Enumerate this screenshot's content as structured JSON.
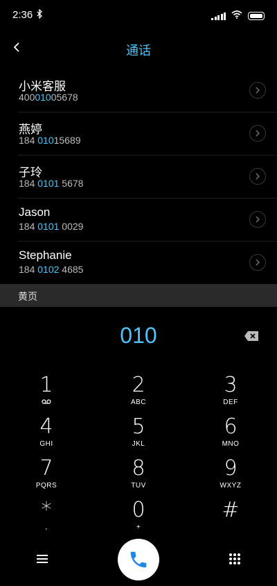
{
  "status": {
    "time": "2:36"
  },
  "header": {
    "title": "通话"
  },
  "contacts": [
    {
      "name": "小米客服",
      "num_pre": "400",
      "num_hl": "010",
      "num_post": "05678"
    },
    {
      "name": "燕婷",
      "num_pre": "184 ",
      "num_hl": "010",
      "num_post": "15689"
    },
    {
      "name": "子玲",
      "num_pre": "184 ",
      "num_hl": "0101",
      "num_post": " 5678"
    },
    {
      "name": "Jason",
      "num_pre": "184 ",
      "num_hl": "0101",
      "num_post": " 0029"
    },
    {
      "name": "Stephanie",
      "num_pre": "184 ",
      "num_hl": "0102",
      "num_post": " 4685"
    }
  ],
  "yellow_pages": {
    "label": "黄页"
  },
  "dial": {
    "digits": "010"
  },
  "keys": [
    {
      "digit": "1",
      "letters": "⊙⊙"
    },
    {
      "digit": "2",
      "letters": "ABC"
    },
    {
      "digit": "3",
      "letters": "DEF"
    },
    {
      "digit": "4",
      "letters": "GHI"
    },
    {
      "digit": "5",
      "letters": "JKL"
    },
    {
      "digit": "6",
      "letters": "MNO"
    },
    {
      "digit": "7",
      "letters": "PQRS"
    },
    {
      "digit": "8",
      "letters": "TUV"
    },
    {
      "digit": "9",
      "letters": "WXYZ"
    },
    {
      "digit": "*",
      "letters": ","
    },
    {
      "digit": "0",
      "letters": "+"
    },
    {
      "digit": "#",
      "letters": ""
    }
  ],
  "colors": {
    "accent": "#4fc3f7",
    "background": "#000000"
  }
}
